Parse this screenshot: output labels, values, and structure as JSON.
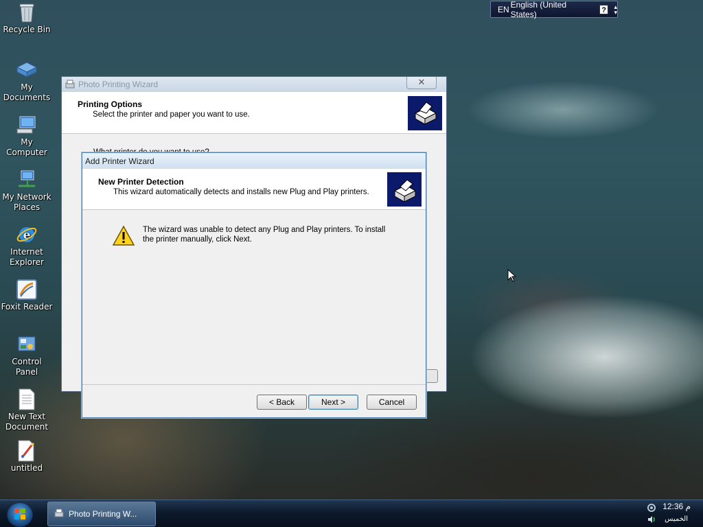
{
  "desktop_icons": [
    {
      "label": "Recycle Bin",
      "icon": "recycle-bin-icon"
    },
    {
      "label": "My Documents",
      "icon": "documents-icon"
    },
    {
      "label": "My Computer",
      "icon": "computer-icon"
    },
    {
      "label": "My Network Places",
      "icon": "network-icon"
    },
    {
      "label": "Internet Explorer",
      "icon": "internet-explorer-icon"
    },
    {
      "label": "Foxit Reader",
      "icon": "foxit-reader-icon"
    },
    {
      "label": "Control Panel",
      "icon": "control-panel-icon"
    },
    {
      "label": "New Text Document",
      "icon": "text-document-icon"
    },
    {
      "label": "untitled",
      "icon": "paint-file-icon"
    }
  ],
  "language_bar": {
    "code": "EN",
    "language": "English (United States)",
    "help": "?"
  },
  "photo_wizard": {
    "title": "Photo Printing Wizard",
    "close": "✕",
    "header_title": "Printing Options",
    "header_subtitle": "Select the printer and paper you want to use.",
    "question": "What printer do you want to use?"
  },
  "add_printer_wizard": {
    "title": "Add Printer Wizard",
    "header_title": "New Printer Detection",
    "header_subtitle": "This wizard automatically detects and installs new Plug and Play printers.",
    "message": "The wizard was unable to detect any Plug and Play printers. To install the printer manually, click Next.",
    "buttons": {
      "back": "< Back",
      "next": "Next >",
      "cancel": "Cancel"
    }
  },
  "taskbar": {
    "task_label": "Photo Printing W...",
    "clock": "12:36 م",
    "day": "الخميس"
  }
}
